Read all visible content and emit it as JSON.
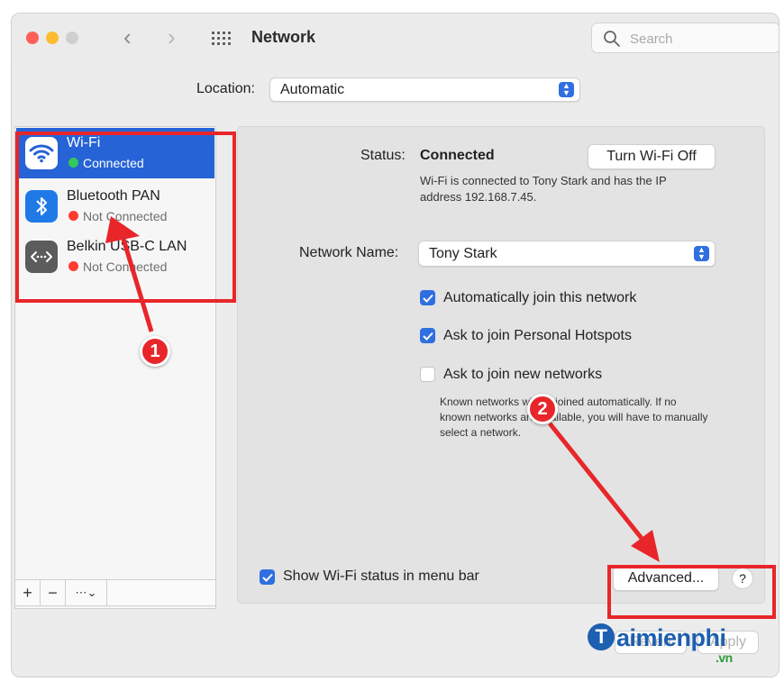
{
  "window": {
    "title": "Network",
    "search_placeholder": "Search"
  },
  "location": {
    "label": "Location:",
    "value": "Automatic"
  },
  "services": [
    {
      "name": "Wi-Fi",
      "status": "Connected",
      "status_color": "#34c759",
      "selected": true,
      "icon": "wifi-icon"
    },
    {
      "name": "Bluetooth PAN",
      "status": "Not Connected",
      "status_color": "#ff3b30",
      "selected": false,
      "icon": "bluetooth-icon"
    },
    {
      "name": "Belkin USB-C LAN",
      "status": "Not Connected",
      "status_color": "#ff3b30",
      "selected": false,
      "icon": "ethernet-icon"
    }
  ],
  "sidebar_toolbar": {
    "add": "+",
    "remove": "−"
  },
  "detail": {
    "status_label": "Status:",
    "status_value": "Connected",
    "turn_off_button": "Turn Wi-Fi Off",
    "status_description": "Wi-Fi is connected to Tony Stark and has the IP address 192.168.7.45.",
    "network_name_label": "Network Name:",
    "network_name_value": "Tony Stark",
    "auto_join": {
      "label": "Automatically join this network",
      "checked": true
    },
    "ask_hotspots": {
      "label": "Ask to join Personal Hotspots",
      "checked": true
    },
    "ask_new": {
      "label": "Ask to join new networks",
      "checked": false
    },
    "known_networks_description": "Known networks will be joined automatically. If no known networks are available, you will have to manually select a network.",
    "show_status": {
      "label": "Show Wi-Fi status in menu bar",
      "checked": true
    },
    "advanced_button": "Advanced...",
    "help_button": "?",
    "revert_button": "Revert",
    "apply_button": "Apply"
  },
  "annotations": {
    "step1": "1",
    "step2": "2",
    "color": "#e8262a"
  },
  "watermark": {
    "brand_initial": "T",
    "brand_rest": "aimienphi",
    "suffix": ".vn"
  }
}
